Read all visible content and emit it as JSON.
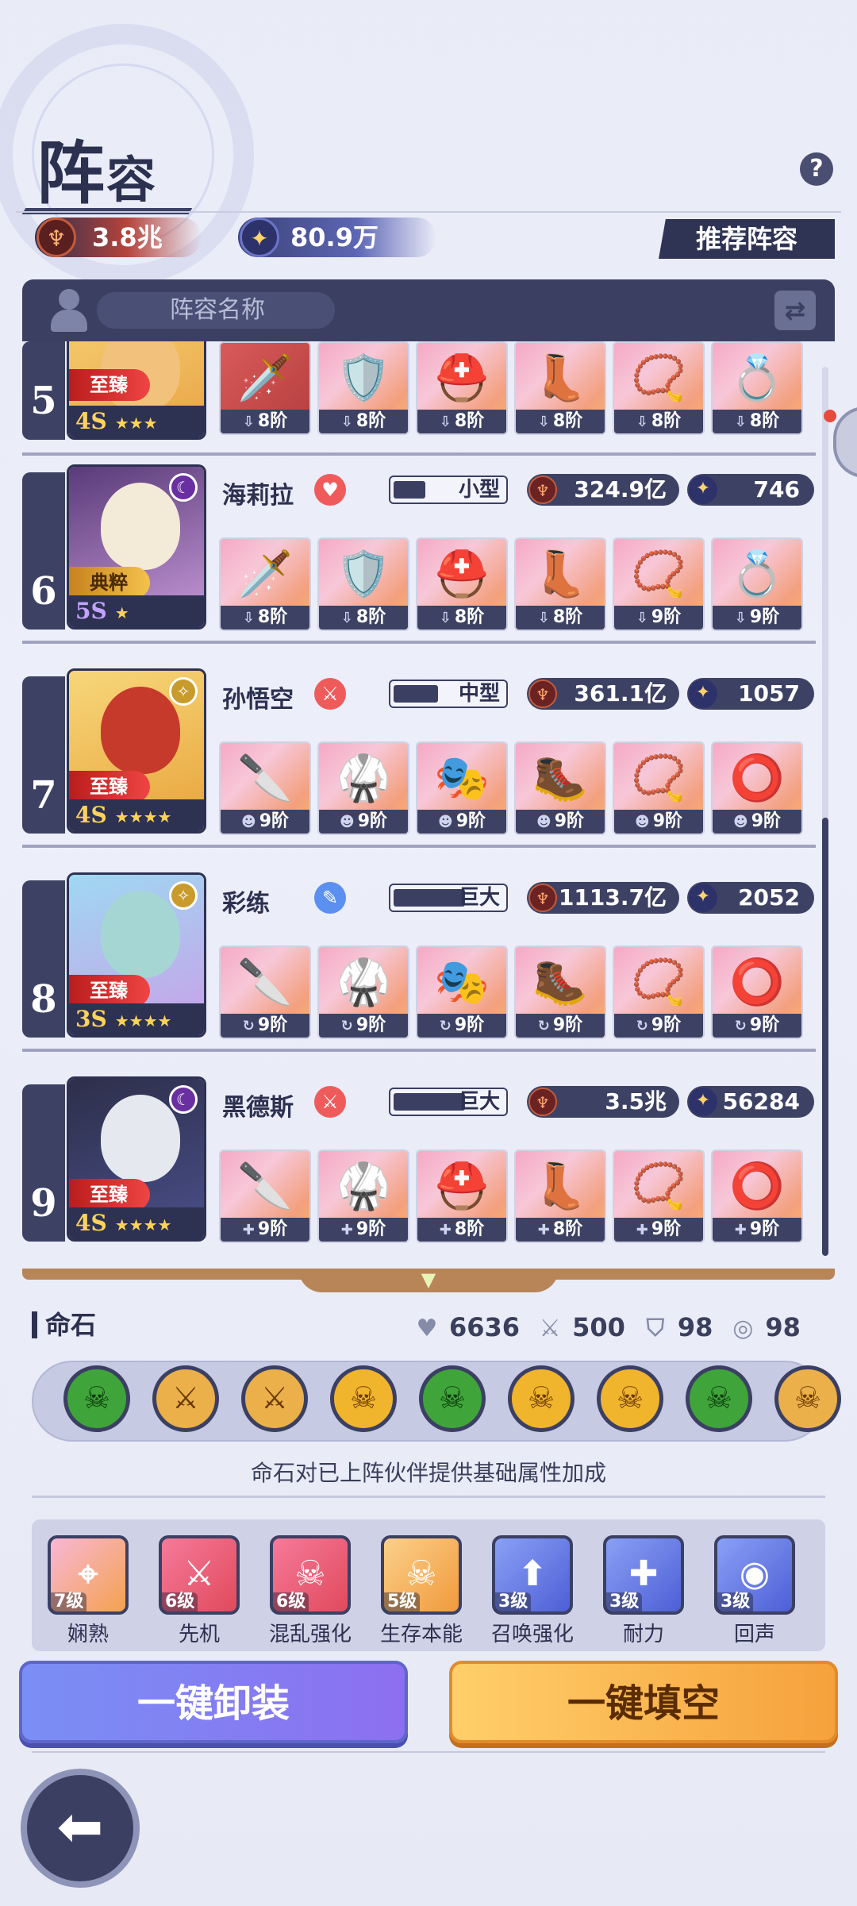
{
  "header": {
    "title_big": "阵",
    "title_small": "容",
    "help": "?"
  },
  "stats": {
    "combat_power": "3.8兆",
    "level_total": "80.9万"
  },
  "recommend_label": "推荐阵容",
  "name_field_placeholder": "阵容名称",
  "heroes": [
    {
      "slot": "5",
      "name": "",
      "tag": "至臻",
      "tier": "4S",
      "stars": "★★★",
      "equip_level_label": "8阶",
      "equips": [
        "8阶",
        "8阶",
        "8阶",
        "8阶",
        "8阶",
        "8阶"
      ]
    },
    {
      "slot": "6",
      "name": "海莉拉",
      "tag": "典粹",
      "tier": "5S",
      "stars": "★",
      "size_label": "小型",
      "size_fill": 0.3,
      "power": "324.9亿",
      "level": "746",
      "equips": [
        "8阶",
        "8阶",
        "8阶",
        "8阶",
        "9阶",
        "9阶"
      ]
    },
    {
      "slot": "7",
      "name": "孙悟空",
      "tag": "至臻",
      "tier": "4S",
      "stars": "★★★★",
      "size_label": "中型",
      "size_fill": 0.45,
      "power": "361.1亿",
      "level": "1057",
      "equips": [
        "9阶",
        "9阶",
        "9阶",
        "9阶",
        "9阶",
        "9阶"
      ]
    },
    {
      "slot": "8",
      "name": "彩练",
      "tag": "至臻",
      "tier": "3S",
      "stars": "★★★★",
      "size_label": "巨大",
      "size_fill": 0.65,
      "power": "1113.7亿",
      "level": "2052",
      "equips": [
        "9阶",
        "9阶",
        "9阶",
        "9阶",
        "9阶",
        "9阶"
      ]
    },
    {
      "slot": "9",
      "name": "黑德斯",
      "tag": "至臻",
      "tier": "4S",
      "stars": "★★★★",
      "size_label": "巨大",
      "size_fill": 0.65,
      "power": "3.5兆",
      "level": "56284",
      "equips": [
        "9阶",
        "9阶",
        "8阶",
        "8阶",
        "9阶",
        "9阶"
      ]
    }
  ],
  "gems": {
    "title": "命石",
    "stats": [
      "6636",
      "500",
      "98",
      "98"
    ],
    "note": "命石对已上阵伙伴提供基础属性加成"
  },
  "skills": [
    {
      "level": "7级",
      "name": "娴熟"
    },
    {
      "level": "6级",
      "name": "先机"
    },
    {
      "level": "6级",
      "name": "混乱强化"
    },
    {
      "level": "5级",
      "name": "生存本能"
    },
    {
      "level": "3级",
      "name": "召唤强化"
    },
    {
      "level": "3级",
      "name": "耐力"
    },
    {
      "level": "3级",
      "name": "回声"
    }
  ],
  "buttons": {
    "unequip": "一键卸装",
    "fill": "一键填空"
  },
  "colors": {
    "accent_dark": "#3b4063",
    "button_blue": "#7a8ff5",
    "button_orange": "#f6a13c"
  }
}
